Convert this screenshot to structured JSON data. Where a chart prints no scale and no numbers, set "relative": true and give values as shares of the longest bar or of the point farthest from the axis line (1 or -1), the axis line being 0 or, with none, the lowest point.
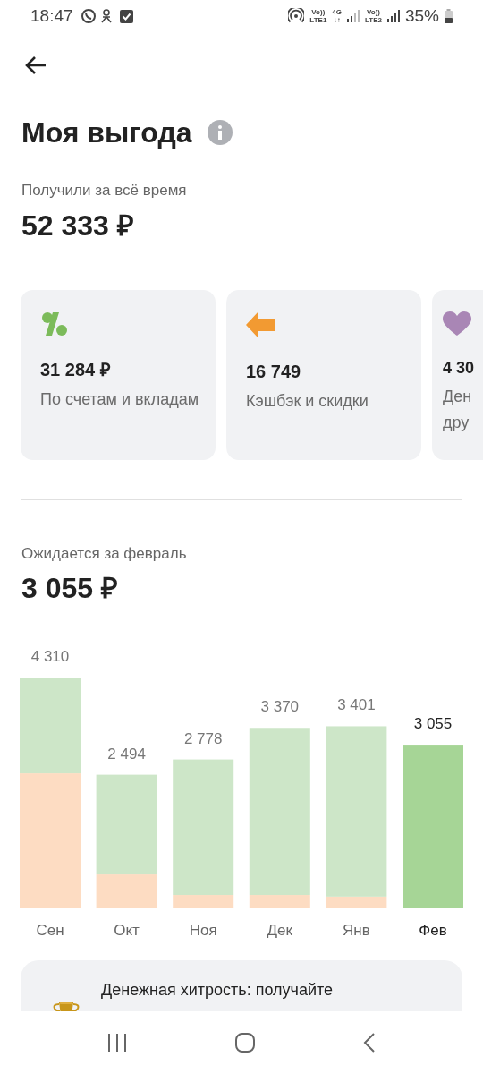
{
  "status_bar": {
    "time": "18:47",
    "indicators": [
      {
        "top": "Vo))",
        "bottom": "LTE1"
      },
      {
        "top": "4G",
        "bottom": "↓↑"
      },
      {
        "top": "Vo))",
        "bottom": "LTE2"
      }
    ],
    "battery": "35%"
  },
  "title": "Моя выгода",
  "total": {
    "label": "Получили за всё время",
    "value": "52 333 ₽"
  },
  "cards": [
    {
      "kind": "percent",
      "value": "31 284 ₽",
      "label": "По счетам и вкладам"
    },
    {
      "kind": "arrow",
      "value": "16 749",
      "label": "Кэшбэк и скидки"
    },
    {
      "kind": "heart",
      "value": "4 30",
      "label": "Ден дру"
    }
  ],
  "expected": {
    "label": "Ожидается за февраль",
    "value": "3 055 ₽"
  },
  "chart": {
    "bars": [
      {
        "selected": false
      },
      {
        "selected": false
      },
      {
        "selected": false
      },
      {
        "selected": false
      },
      {
        "selected": false
      },
      {
        "selected": true
      }
    ],
    "chart_data": {
      "type": "bar",
      "categories": [
        "Сен",
        "Окт",
        "Ноя",
        "Дек",
        "Янв",
        "Фев"
      ],
      "stacked": true,
      "relative": true,
      "series": [
        {
          "color": "#fddcc2",
          "values": [
            0.585,
            0.147,
            0.058,
            0.058,
            0.051,
            0
          ]
        },
        {
          "color": "#cde6c8",
          "values": [
            0.415,
            0.432,
            0.587,
            0.724,
            0.738,
            null
          ]
        },
        {
          "color": "#a6d596",
          "values": [
            null,
            null,
            null,
            null,
            null,
            0.709
          ]
        }
      ],
      "annotations": [
        "4 310",
        "2 494",
        "2 778",
        "3 370",
        "3 401",
        "3 055"
      ]
    }
  },
  "banner": {
    "text": "Денежная хитрость: получайте"
  }
}
